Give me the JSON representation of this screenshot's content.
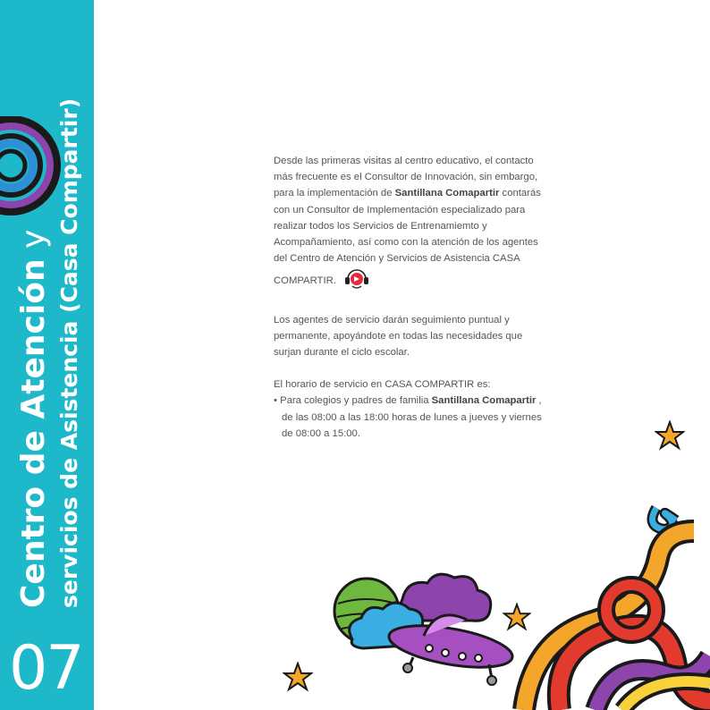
{
  "sidebar": {
    "title_bold": "Centro de Atención",
    "title_light": " y",
    "subtitle": "servicios de Asistencia (Casa Compartir)",
    "chapter": "07",
    "color": "#1db8c9"
  },
  "content": {
    "p1_a": "Desde las primeras visitas al centro educativo, el contacto más frecuente es el Consultor de Innovación, sin embargo, para la implementación de ",
    "p1_bold": "Santillana Comapartir",
    "p1_b": " contarás con un Consultor de Implementación especializado para realizar todos los Servicios de Entrenamiemto y Acompañamiento, así como con la atención de los agentes del Centro de Atención y Servicios de Asistencia CASA COMPARTIR.",
    "p2": "Los agentes de servicio darán seguimiento puntual y permanente, apoyándote en todas las necesidades que surjan durante el ciclo escolar.",
    "p3": "El horario de servicio en CASA COMPARTIR es:",
    "bullet_a": "• Para colegios y padres de familia ",
    "bullet_bold": "Santillana Comapartir",
    "bullet_b": " , de las 08:00 a las 18:00 horas de lunes a jueves y viernes de 08:00 a 15:00."
  },
  "icons": {
    "headset": "headset-icon",
    "accent": "#e8283c"
  }
}
